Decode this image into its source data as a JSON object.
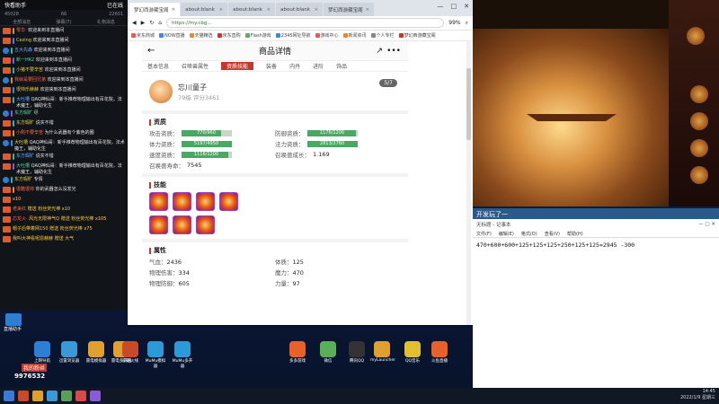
{
  "chat": {
    "title": "快看助手",
    "status": "已在线",
    "stats": [
      "45028",
      "66",
      "22601"
    ],
    "tabs": [
      "全部消息",
      "弹幕(7)",
      "礼物消息"
    ],
    "messages": [
      {
        "name": "零华·",
        "text": "欢迎来到本直播间"
      },
      {
        "name": "Cezing",
        "text": "欢迎来到本直播间"
      },
      {
        "name": "五大先森",
        "text": "欢迎来到本直播间"
      },
      {
        "name": "新一HK2",
        "text": "欢迎来到本直播间"
      },
      {
        "name": "小猪不要辛苦",
        "text": "欢迎来到本直播间"
      },
      {
        "name": "我就是要回兄弟",
        "text": "欢迎来到本直播间"
      },
      {
        "name": "很帅乐赫赫",
        "text": "欢迎来到本直播间"
      },
      {
        "name": "大吐槽",
        "text": "QAQ神仙哥：新手推荐物理输出有百花院，法术魔王，辅助化生"
      },
      {
        "name": "东方瑕旷",
        "text": "尽"
      },
      {
        "name": "东方瑕旷",
        "text": "说实不错"
      },
      {
        "name": "小刚不要辛苦",
        "text": "为什么武器有个紫色的圈"
      },
      {
        "name": "大吐槽",
        "text": "QAQ神仙哥：新手推荐物理输出有百花院，法术魔王，辅助化生"
      },
      {
        "name": "东方瑕旷",
        "text": "说实不错"
      },
      {
        "name": "大吐槽",
        "text": "QAQ神仙哥：新手推荐物理输出有百花院，法术魔王，辅助化生"
      },
      {
        "name": "东方瑕旷",
        "text": "专情"
      },
      {
        "name": "很酷很帅",
        "text": "你的武器怎么没发光"
      }
    ],
    "gifts": [
      {
        "name": "",
        "text": "x10"
      },
      {
        "name": "老来红",
        "text": "赠送 粉丝荧光棒 x10"
      },
      {
        "name": "芯龙火·",
        "text": "风光无限神气Q 赠送 粉丝荧光棒 x105"
      },
      {
        "name": "",
        "text": "帽子后带着网150 赠送 粉丝荧光棒 x75"
      },
      {
        "name": "",
        "text": "我叫大神看呢恩赫赫 赠送 大气"
      }
    ]
  },
  "live": {
    "label": "直播助手",
    "fan_label": "我的粉丝",
    "fan_count": "9976532"
  },
  "browser": {
    "tabs": [
      "梦幻西游藏宝阁",
      "about:blank",
      "about:blank",
      "about:blank",
      "梦幻西游藏宝阁"
    ],
    "url": "https://my.cbg...",
    "zoom": "99%",
    "window_title": "梦幻2电脑版 2.0.1",
    "bookmarks": [
      "京东商城",
      "NOW直播",
      "天猫精选",
      "京东直购",
      "Flash游戏",
      "2345网址导航",
      "游戏中心",
      "新闻资讯",
      "个人专栏",
      "梦幻西游藏宝阁"
    ]
  },
  "page": {
    "title": "商品详情",
    "tabs": [
      "基本信息",
      "召唤兽属性",
      "资质技能",
      "装备",
      "内丹",
      "进阶",
      "饰品"
    ],
    "active_tab_index": 2,
    "pet": {
      "name": "忘川童子",
      "level_line": "79级 评分3461",
      "page": "5/7"
    },
    "sections": {
      "aptitude": "资质",
      "skills": "技能",
      "attrs": "属性"
    },
    "aptitudes": [
      {
        "label": "攻击资质：",
        "value": "770/960",
        "fill": 0.8
      },
      {
        "label": "防御资质：",
        "value": "1176/1200",
        "fill": 0.98
      },
      {
        "label": "体力资质：",
        "value": "5197/4950",
        "fill": 1.0
      },
      {
        "label": "法力资质：",
        "value": "2813/2760",
        "fill": 1.0
      },
      {
        "label": "速度资质：",
        "value": "1116/1200",
        "fill": 0.93
      }
    ],
    "growth_label": "召唤兽成长：",
    "growth": "1.169",
    "life_label": "召唤兽寿命：",
    "life": "7545",
    "skill_count": 7,
    "attributes": [
      {
        "label": "气血：",
        "value": "2436"
      },
      {
        "label": "体质：",
        "value": "125"
      },
      {
        "label": "物理伤害：",
        "value": "334"
      },
      {
        "label": "魔力：",
        "value": "470"
      },
      {
        "label": "物理防御：",
        "value": "605"
      },
      {
        "label": "力量：",
        "value": "97"
      }
    ]
  },
  "notepad": {
    "title": "开发玩了一",
    "file": "无标题 - 记事本",
    "menu": [
      "文件(F)",
      "编辑(E)",
      "格式(O)",
      "查看(V)",
      "帮助(H)"
    ],
    "content": "470+600+600+125+125+125+250+125+125=2945  -300"
  },
  "game": {
    "side_label": "攻略"
  },
  "desktop_icons": [
    "上网导航",
    "迅雷浏览器",
    "雷电模拟器",
    "雷电多开器",
    "穿越火线",
    "MuMu模拟器",
    "MuMu多开器",
    "多多游戏",
    "微信",
    "腾讯QQ",
    "myLauncher",
    "QQ音乐",
    "斗鱼直播"
  ],
  "tray": {
    "time": "14:45",
    "date": "2022/1/9 星期三"
  }
}
